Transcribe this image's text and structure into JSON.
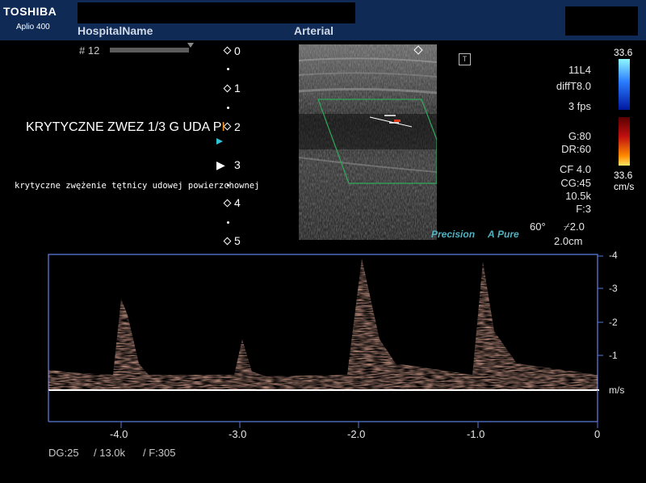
{
  "header": {
    "brand": "TOSHIBA",
    "model": "Aplio 400",
    "hospital": "HospitalName",
    "preset": "Arterial"
  },
  "cine": {
    "frame": "# 12"
  },
  "depth_scale": {
    "labels": [
      "0",
      "1",
      "2",
      "3",
      "4",
      "5"
    ],
    "focus_marker": "▶"
  },
  "annotations": {
    "line1": "KRYTYCZNE ZWEZ 1/3 G UDA P",
    "line1_cursor": "I",
    "line2": "krytyczne zwężenie tętnicy udowej powierzchownej"
  },
  "image_branding": {
    "precision": "Precision",
    "pure_symbol": "A",
    "pure": "Pure"
  },
  "parameters": {
    "probe": "11L4",
    "mode": "diffT8.0",
    "fps": "3 fps",
    "gain": "G:80",
    "dynamic_range": "DR:60",
    "cf": "CF 4.0",
    "cg": "CG:45",
    "prf": "10.5k",
    "filter": "F:3",
    "angle": "60°",
    "angle_sym": "⌿2.0",
    "sample_volume": "2.0cm"
  },
  "color_scale": {
    "top": "33.6",
    "bottom": "33.6",
    "unit": "cm/s",
    "colors": {
      "positive_top": "#8ff8ff",
      "positive_bottom": "#0018a0",
      "negative_top": "#5a0000",
      "negative_bottom": "#ffe866"
    }
  },
  "spectral": {
    "y_labels": [
      "-4",
      "-3",
      "-2",
      "-1",
      "m/s"
    ],
    "x_labels": [
      "-4.0",
      "-3.0",
      "-2.0",
      "-1.0",
      "0"
    ],
    "baseline_color": "#ffffff",
    "frame_color": "#5a7ad6",
    "spectrum_color": "#d98a72"
  },
  "footer": {
    "dg": "DG:25",
    "prf": "/ 13.0k",
    "frame_rate": "/ F:305"
  }
}
